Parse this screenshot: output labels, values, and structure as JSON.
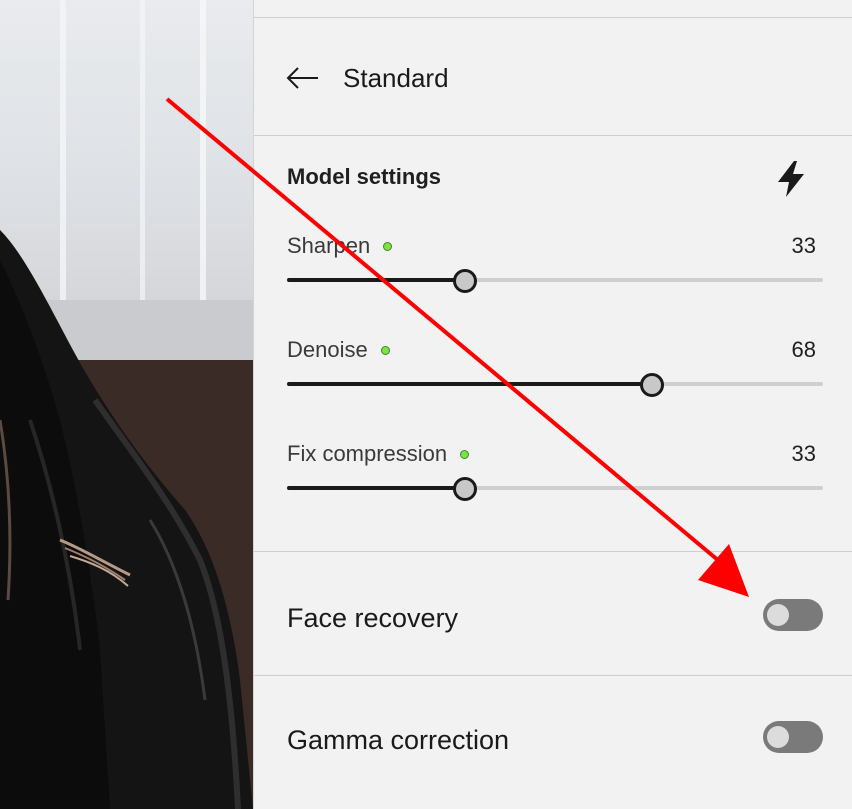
{
  "header": {
    "title": "Standard",
    "back_icon": "arrow-left-icon"
  },
  "model_settings": {
    "title": "Model settings",
    "action_icon": "lightning-bolt-icon",
    "sliders": [
      {
        "label": "Sharpen",
        "value": "33",
        "level_percent": 33,
        "indicator_color": "#7ee04a"
      },
      {
        "label": "Denoise",
        "value": "68",
        "level_percent": 68,
        "indicator_color": "#7ee04a"
      },
      {
        "label": "Fix compression",
        "value": "33",
        "level_percent": 33,
        "indicator_color": "#7ee04a"
      }
    ]
  },
  "toggles": [
    {
      "label": "Face recovery",
      "on": false
    },
    {
      "label": "Gamma correction",
      "on": false
    }
  ],
  "annotation": {
    "arrow_color": "#ff0000"
  }
}
